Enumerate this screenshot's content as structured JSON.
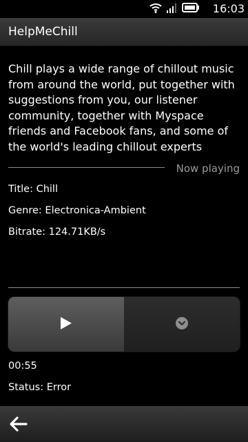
{
  "status_bar": {
    "time": "16:03",
    "icons": [
      "wifi-icon",
      "signal-icon",
      "battery-icon"
    ]
  },
  "header": {
    "title": "HelpMeChill"
  },
  "station": {
    "description": "Chill plays a wide range of chillout music from around the world, put together with suggestions from you, our listener community, together with Myspace friends and Facebook fans, and some of the world's leading chillout experts",
    "now_playing_label": "Now playing",
    "title_line": "Title: Chill",
    "genre_line": "Genre: Electronica-Ambient",
    "bitrate_line": "Bitrate: 124.71KB/s"
  },
  "player": {
    "controls": [
      "play-icon",
      "chevron-down-icon"
    ],
    "elapsed": "00:55",
    "status_line": "Status: Error"
  },
  "toolbar": {
    "icons": [
      "back-arrow-icon"
    ]
  },
  "colors": {
    "background": "#000000",
    "divider": "#8a8a8a",
    "muted_text": "#9a9a9a"
  }
}
